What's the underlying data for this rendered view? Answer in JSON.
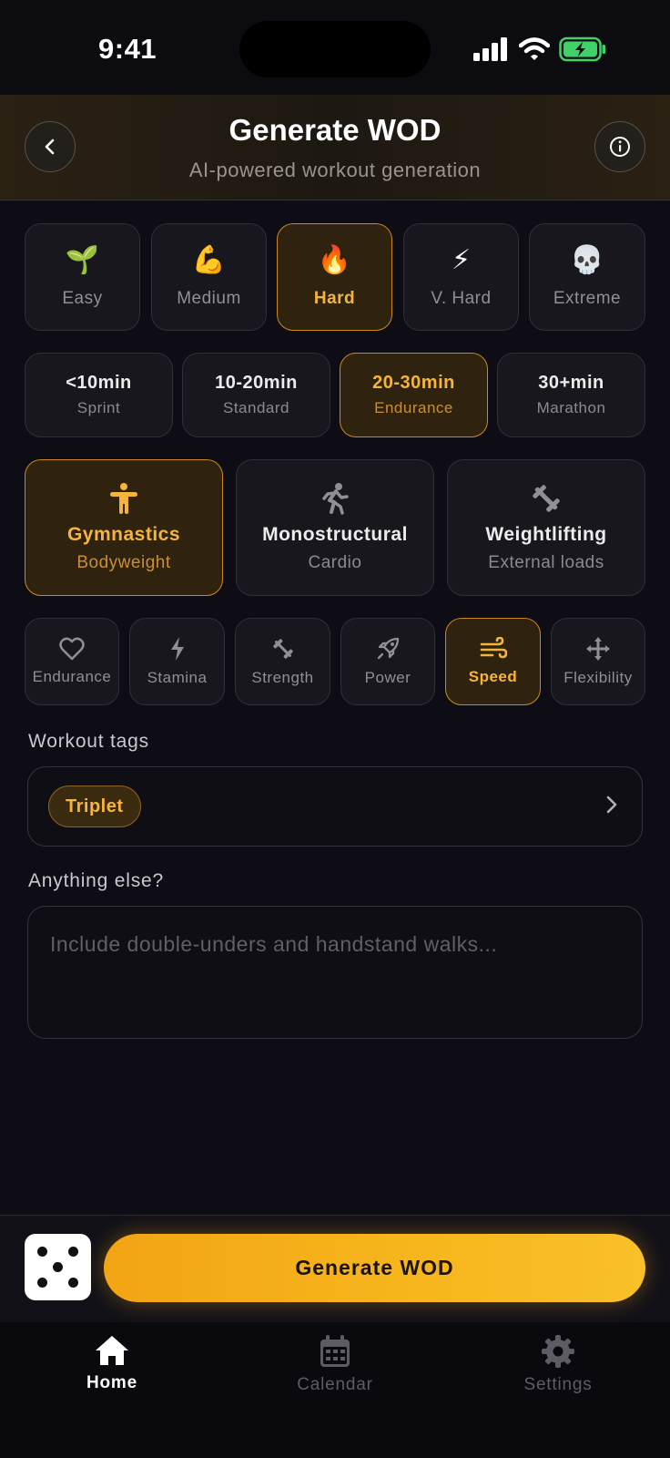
{
  "status_bar": {
    "time": "9:41"
  },
  "header": {
    "title": "Generate WOD",
    "subtitle": "AI-powered workout generation"
  },
  "difficulty": [
    {
      "icon": "seedling-icon",
      "emoji": "🌱",
      "label": "Easy",
      "selected": false
    },
    {
      "icon": "flexed-biceps-icon",
      "emoji": "💪",
      "label": "Medium",
      "selected": false
    },
    {
      "icon": "fire-icon",
      "emoji": "🔥",
      "label": "Hard",
      "selected": true
    },
    {
      "icon": "lightning-icon",
      "emoji": "⚡",
      "label": "V. Hard",
      "selected": false
    },
    {
      "icon": "skull-icon",
      "emoji": "💀",
      "label": "Extreme",
      "selected": false
    }
  ],
  "duration": [
    {
      "main": "<10min",
      "sub": "Sprint",
      "selected": false
    },
    {
      "main": "10-20min",
      "sub": "Standard",
      "selected": false
    },
    {
      "main": "20-30min",
      "sub": "Endurance",
      "selected": true
    },
    {
      "main": "30+min",
      "sub": "Marathon",
      "selected": false
    }
  ],
  "modality": [
    {
      "icon": "gymnastics-icon",
      "main": "Gymnastics",
      "sub": "Bodyweight",
      "selected": true
    },
    {
      "icon": "running-icon",
      "main": "Monostructural",
      "sub": "Cardio",
      "selected": false
    },
    {
      "icon": "barbell-icon",
      "main": "Weightlifting",
      "sub": "External loads",
      "selected": false
    }
  ],
  "focus": [
    {
      "icon": "heart-icon",
      "label": "Endurance",
      "selected": false
    },
    {
      "icon": "bolt-icon",
      "label": "Stamina",
      "selected": false
    },
    {
      "icon": "dumbbell-icon",
      "label": "Strength",
      "selected": false
    },
    {
      "icon": "rocket-icon",
      "label": "Power",
      "selected": false
    },
    {
      "icon": "wind-icon",
      "label": "Speed",
      "selected": true
    },
    {
      "icon": "arrows-move-icon",
      "label": "Flexibility",
      "selected": false
    }
  ],
  "tags": {
    "label": "Workout tags",
    "chips": [
      "Triplet"
    ]
  },
  "notes": {
    "label": "Anything else?",
    "placeholder": "Include double-unders and handstand walks..."
  },
  "generate_button": "Generate WOD",
  "tabs": [
    {
      "icon": "home-icon",
      "label": "Home",
      "active": true
    },
    {
      "icon": "calendar-icon",
      "label": "Calendar",
      "active": false
    },
    {
      "icon": "gear-icon",
      "label": "Settings",
      "active": false
    }
  ],
  "colors": {
    "accent": "#f5b53c",
    "background": "#0e0d15",
    "tile": "#17171d"
  }
}
